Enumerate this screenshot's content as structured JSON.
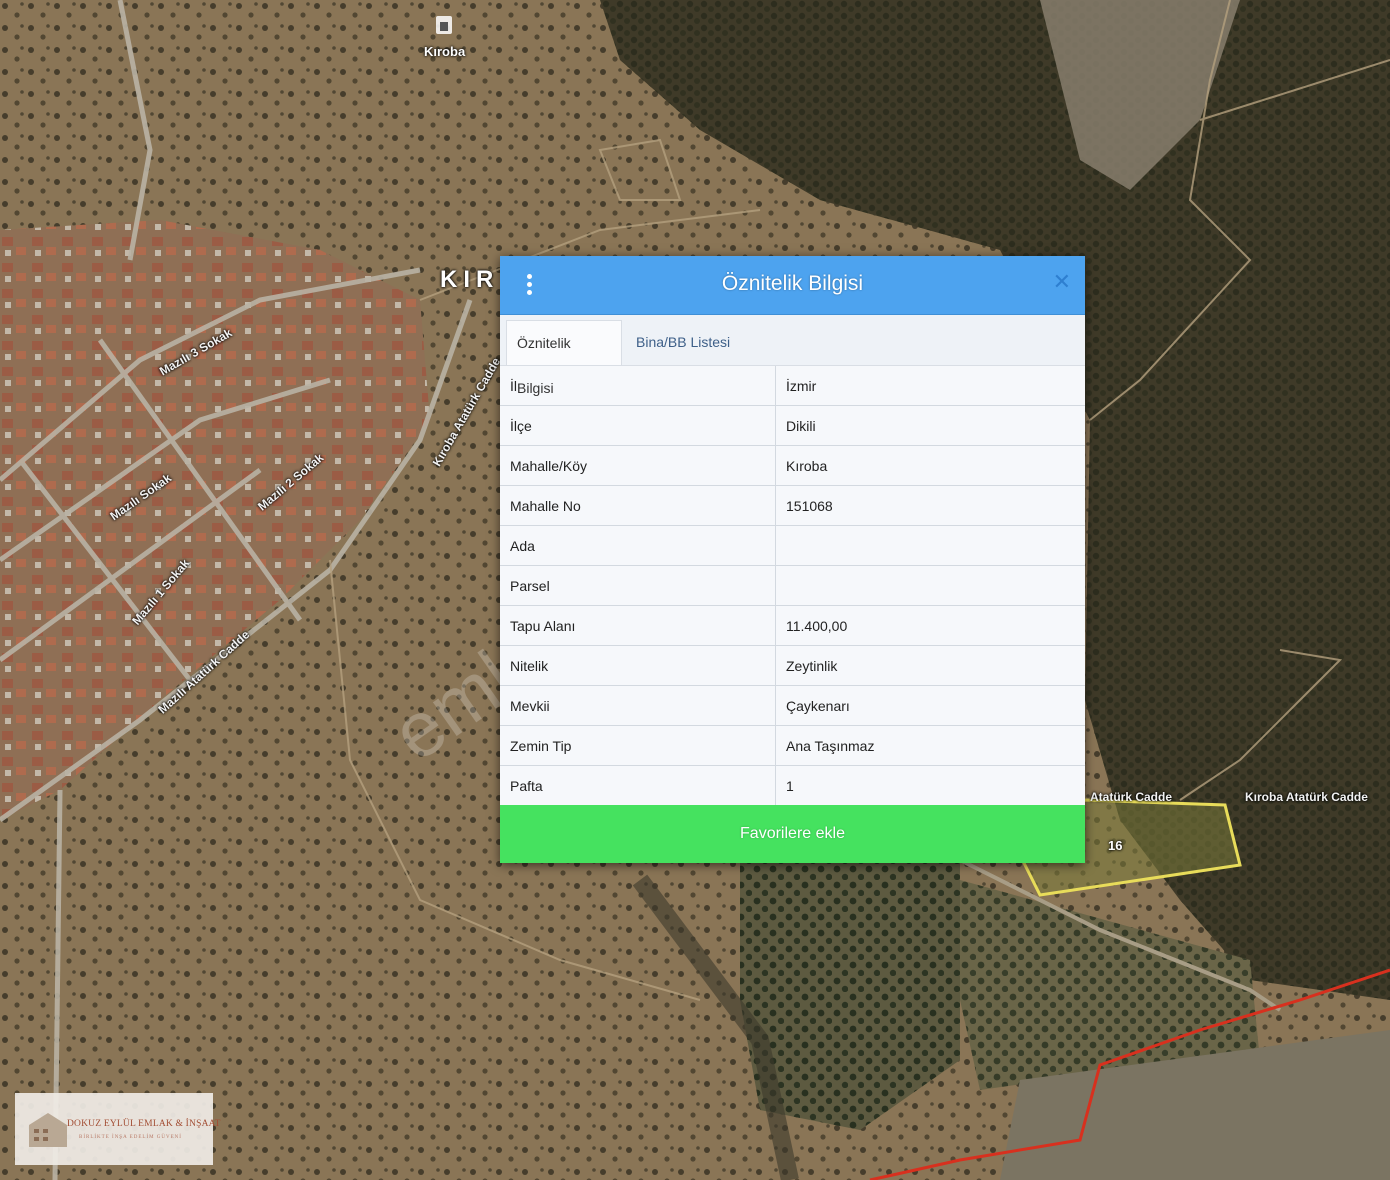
{
  "map": {
    "village_label": "Kıroba",
    "village_big_label": "KIR",
    "streets": [
      "Mazılı 3 Sokak",
      "Kıroba Atatürk Cadde",
      "Mazılı 2 Sokak",
      "Mazılı 1 Sokak",
      "Mazılı Sokak",
      "Mazılı Atatürk Cadde",
      "Kıroba Atatürk Cadde",
      "Atatürk Cadde"
    ],
    "parcel_label": "16",
    "parcel_color": "#e8dc5a",
    "boundary_color": "#d8301e"
  },
  "dialog": {
    "title": "Öznitelik Bilgisi",
    "tabs": [
      "Öznitelik Bilgisi",
      "Bina/BB Listesi"
    ],
    "rows": [
      {
        "key": "İl",
        "value": "İzmir"
      },
      {
        "key": "İlçe",
        "value": "Dikili"
      },
      {
        "key": "Mahalle/Köy",
        "value": "Kıroba"
      },
      {
        "key": "Mahalle No",
        "value": "151068"
      },
      {
        "key": "Ada",
        "value": ""
      },
      {
        "key": "Parsel",
        "value": ""
      },
      {
        "key": "Tapu Alanı",
        "value": "11.400,00"
      },
      {
        "key": "Nitelik",
        "value": "Zeytinlik"
      },
      {
        "key": "Mevkii",
        "value": "Çaykenarı"
      },
      {
        "key": "Zemin Tip",
        "value": "Ana Taşınmaz"
      },
      {
        "key": "Pafta",
        "value": "1"
      }
    ],
    "favorite_button": "Favorilere ekle",
    "header_color": "#4da3ef",
    "button_color": "#45e25f"
  },
  "watermark": "emlakjet.com",
  "logo": {
    "name": "DOKUZ EYLÜL EMLAK & İNŞAAT",
    "tagline": "BİRLİKTE İNŞA EDELİM GÜVENİ"
  }
}
